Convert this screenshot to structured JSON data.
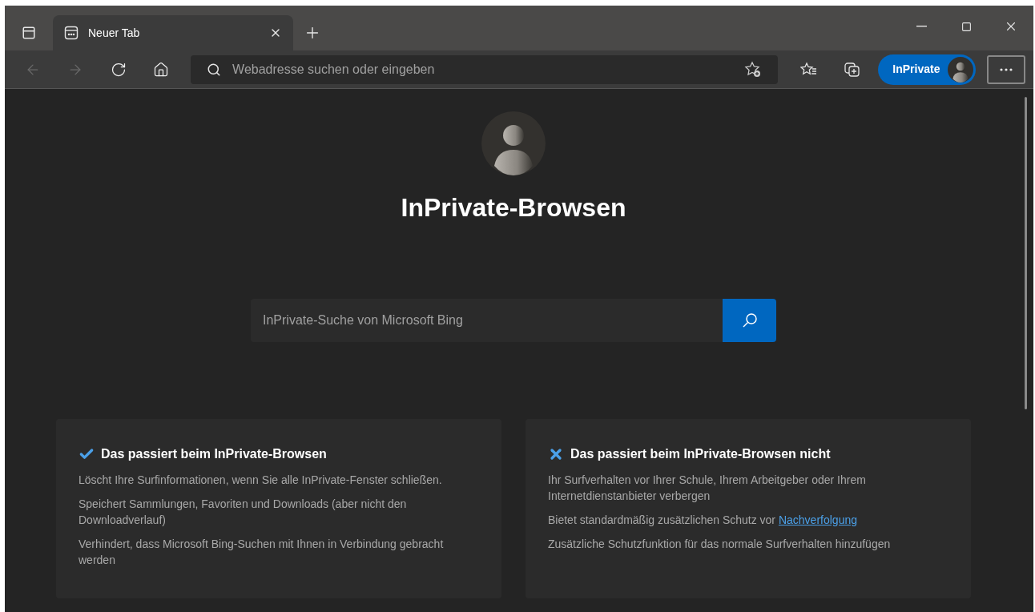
{
  "tabs": [
    {
      "label": "Neuer Tab",
      "selected": true
    }
  ],
  "toolbar": {
    "nav": [
      {
        "kind": "back",
        "disabled": true
      },
      {
        "kind": "forward",
        "disabled": true
      },
      {
        "kind": "refresh",
        "disabled": false
      },
      {
        "kind": "home",
        "disabled": false
      }
    ],
    "address": {
      "placeholder": "Webadresse suchen oder eingeben"
    },
    "profile_label": "InPrivate"
  },
  "page": {
    "title": "InPrivate-Browsen",
    "search": {
      "placeholder": "InPrivate-Suche von Microsoft Bing"
    },
    "cards": [
      {
        "kind": "check",
        "title": "Das passiert beim InPrivate-Browsen",
        "items": [
          {
            "text": "Löscht Ihre Surfinformationen, wenn Sie alle InPrivate-Fenster schließen."
          },
          {
            "text": "Speichert Sammlungen, Favoriten und Downloads (aber nicht den Downloadverlauf)"
          },
          {
            "text": "Verhindert, dass Microsoft Bing-Suchen mit Ihnen in Verbindung gebracht werden"
          }
        ]
      },
      {
        "kind": "cross",
        "title": "Das passiert beim InPrivate-Browsen nicht",
        "items": [
          {
            "text": "Ihr Surfverhalten vor Ihrer Schule, Ihrem Arbeitgeber oder Ihrem Internetdienstanbieter verbergen"
          },
          {
            "text": "Bietet standardmäßig zusätzlichen Schutz vor",
            "link": "Nachverfolgung"
          },
          {
            "text": "Zusätzliche Schutzfunktion für das normale Surfverhalten hinzufügen"
          }
        ]
      }
    ]
  }
}
